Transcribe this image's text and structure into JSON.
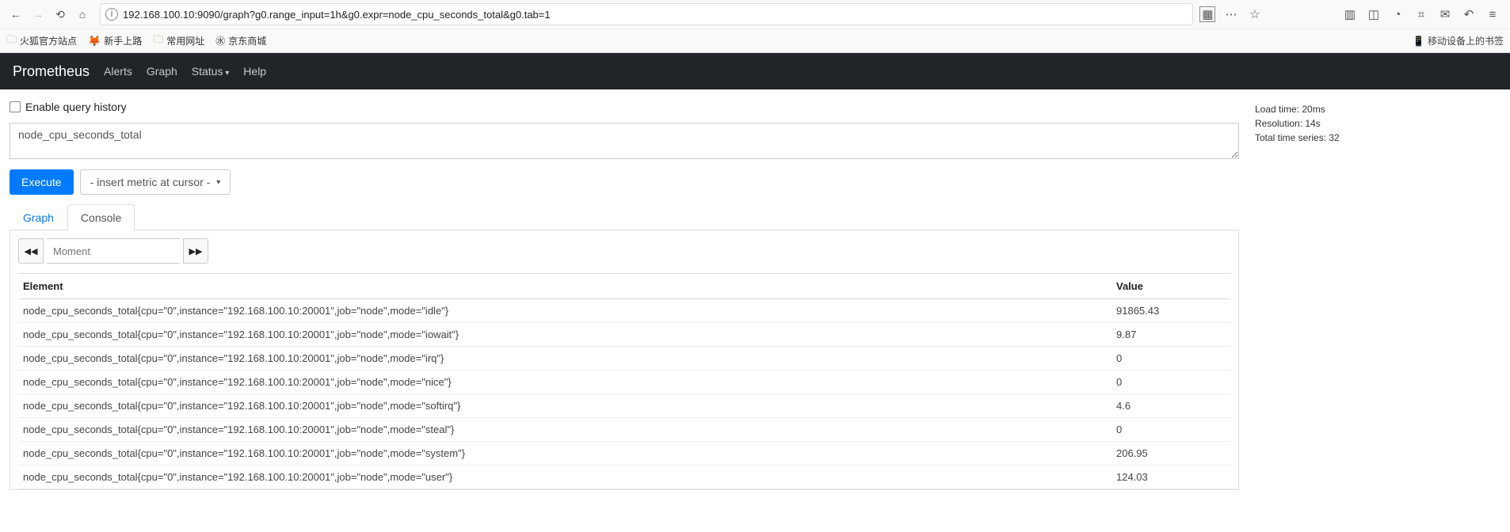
{
  "browser": {
    "url_full": "192.168.100.10:9090/graph?g0.range_input=1h&g0.expr=node_cpu_seconds_total&g0.tab=1",
    "bookmarks": [
      {
        "label": "火狐官方站点",
        "icon": "folder"
      },
      {
        "label": "新手上路",
        "icon": "firefox"
      },
      {
        "label": "常用网址",
        "icon": "folder"
      },
      {
        "label": "京东商城",
        "icon": "globe"
      }
    ],
    "mobile_label": "移动设备上的书签"
  },
  "prom": {
    "brand": "Prometheus",
    "nav": {
      "alerts": "Alerts",
      "graph": "Graph",
      "status": "Status",
      "help": "Help"
    }
  },
  "query": {
    "enable_history_label": "Enable query history",
    "expression": "node_cpu_seconds_total",
    "execute_label": "Execute",
    "metric_select_label": "- insert metric at cursor -"
  },
  "stats": {
    "load_time": "Load time: 20ms",
    "resolution": "Resolution: 14s",
    "series": "Total time series: 32"
  },
  "tabs": {
    "graph": "Graph",
    "console": "Console"
  },
  "moment_placeholder": "Moment",
  "table": {
    "col_element": "Element",
    "col_value": "Value",
    "rows": [
      {
        "element": "node_cpu_seconds_total{cpu=\"0\",instance=\"192.168.100.10:20001\",job=\"node\",mode=\"idle\"}",
        "value": "91865.43"
      },
      {
        "element": "node_cpu_seconds_total{cpu=\"0\",instance=\"192.168.100.10:20001\",job=\"node\",mode=\"iowait\"}",
        "value": "9.87"
      },
      {
        "element": "node_cpu_seconds_total{cpu=\"0\",instance=\"192.168.100.10:20001\",job=\"node\",mode=\"irq\"}",
        "value": "0"
      },
      {
        "element": "node_cpu_seconds_total{cpu=\"0\",instance=\"192.168.100.10:20001\",job=\"node\",mode=\"nice\"}",
        "value": "0"
      },
      {
        "element": "node_cpu_seconds_total{cpu=\"0\",instance=\"192.168.100.10:20001\",job=\"node\",mode=\"softirq\"}",
        "value": "4.6"
      },
      {
        "element": "node_cpu_seconds_total{cpu=\"0\",instance=\"192.168.100.10:20001\",job=\"node\",mode=\"steal\"}",
        "value": "0"
      },
      {
        "element": "node_cpu_seconds_total{cpu=\"0\",instance=\"192.168.100.10:20001\",job=\"node\",mode=\"system\"}",
        "value": "206.95"
      },
      {
        "element": "node_cpu_seconds_total{cpu=\"0\",instance=\"192.168.100.10:20001\",job=\"node\",mode=\"user\"}",
        "value": "124.03"
      }
    ]
  }
}
